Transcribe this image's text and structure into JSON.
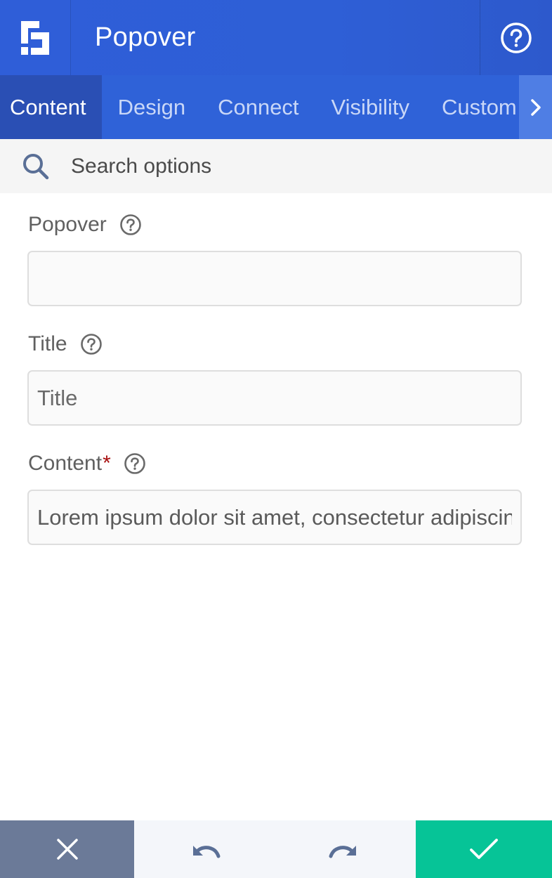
{
  "header": {
    "title": "Popover",
    "logo_icon": "builder-logo-icon",
    "help_icon": "question-circle-icon"
  },
  "tabs": [
    {
      "label": "Content",
      "active": true
    },
    {
      "label": "Design",
      "active": false
    },
    {
      "label": "Connect",
      "active": false
    },
    {
      "label": "Visibility",
      "active": false
    },
    {
      "label": "Custom",
      "active": false
    }
  ],
  "tabs_scroll_icon": "chevron-right-icon",
  "search": {
    "placeholder": "Search options",
    "icon": "search-icon"
  },
  "form": {
    "popover": {
      "label": "Popover",
      "value": "",
      "placeholder": ""
    },
    "title": {
      "label": "Title",
      "value": "",
      "placeholder": "Title"
    },
    "content": {
      "label": "Content",
      "required_mark": "*",
      "value": "Lorem ipsum dolor sit amet, consectetur adipiscing elit.",
      "placeholder": ""
    }
  },
  "footer": {
    "close_icon": "close-icon",
    "undo_icon": "undo-icon",
    "redo_icon": "redo-icon",
    "save_icon": "checkmark-icon"
  },
  "colors": {
    "header_blue": "#2f5ed8",
    "tab_active": "#2a4fb4",
    "tab_scroll": "#4f7ee4",
    "close_button": "#6b7a98",
    "save_button": "#06c497",
    "required_mark": "#a80f0f"
  }
}
